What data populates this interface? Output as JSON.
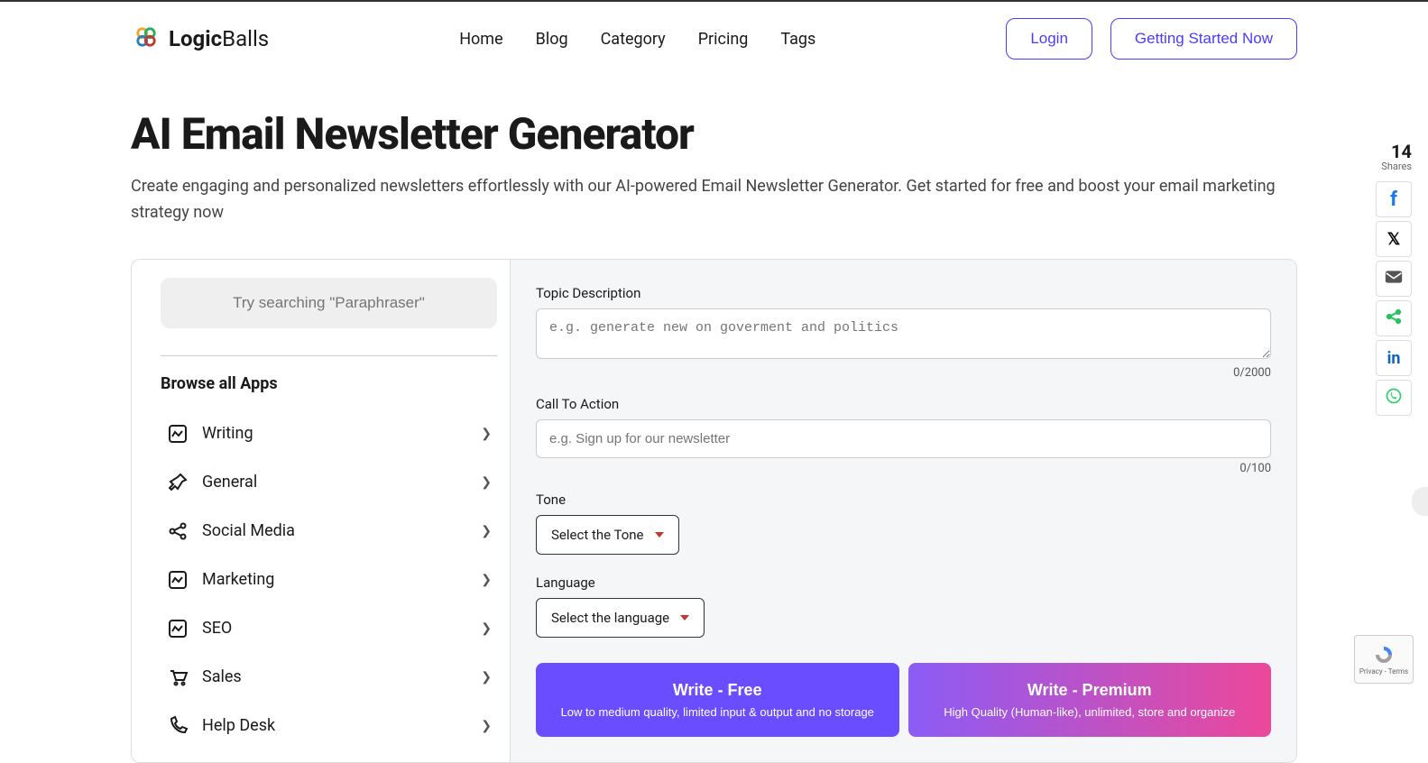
{
  "brand": {
    "name_bold": "Logic",
    "name_light": "Balls"
  },
  "nav": [
    "Home",
    "Blog",
    "Category",
    "Pricing",
    "Tags"
  ],
  "header_buttons": {
    "login": "Login",
    "cta": "Getting Started Now"
  },
  "page": {
    "title": "AI Email Newsletter Generator",
    "subtitle": "Create engaging and personalized newsletters effortlessly with our AI-powered Email Newsletter Generator. Get started for free and boost your email marketing strategy now"
  },
  "sidebar": {
    "search_placeholder": "Try searching \"Paraphraser\"",
    "browse_title": "Browse all Apps",
    "categories": [
      {
        "label": "Writing",
        "icon": "writing"
      },
      {
        "label": "General",
        "icon": "pin"
      },
      {
        "label": "Social Media",
        "icon": "share"
      },
      {
        "label": "Marketing",
        "icon": "marketing"
      },
      {
        "label": "SEO",
        "icon": "seo"
      },
      {
        "label": "Sales",
        "icon": "cart"
      },
      {
        "label": "Help Desk",
        "icon": "phone"
      }
    ]
  },
  "form": {
    "topic_label": "Topic Description",
    "topic_placeholder": "e.g. generate new on goverment and politics",
    "topic_counter": "0/2000",
    "cta_label": "Call To Action",
    "cta_placeholder": "e.g. Sign up for our newsletter",
    "cta_counter": "0/100",
    "tone_label": "Tone",
    "tone_select": "Select the Tone",
    "lang_label": "Language",
    "lang_select": "Select the language",
    "btn_free_title": "Write - Free",
    "btn_free_sub": "Low to medium quality, limited input & output and no storage",
    "btn_premium_title": "Write - Premium",
    "btn_premium_sub": "High Quality (Human-like), unlimited, store and organize"
  },
  "share": {
    "count": "14",
    "label": "Shares",
    "networks": [
      "facebook",
      "x",
      "email",
      "sharethis",
      "linkedin",
      "whatsapp"
    ]
  },
  "recaptcha": {
    "line1": "Privacy",
    "sep": " - ",
    "line2": "Terms"
  }
}
